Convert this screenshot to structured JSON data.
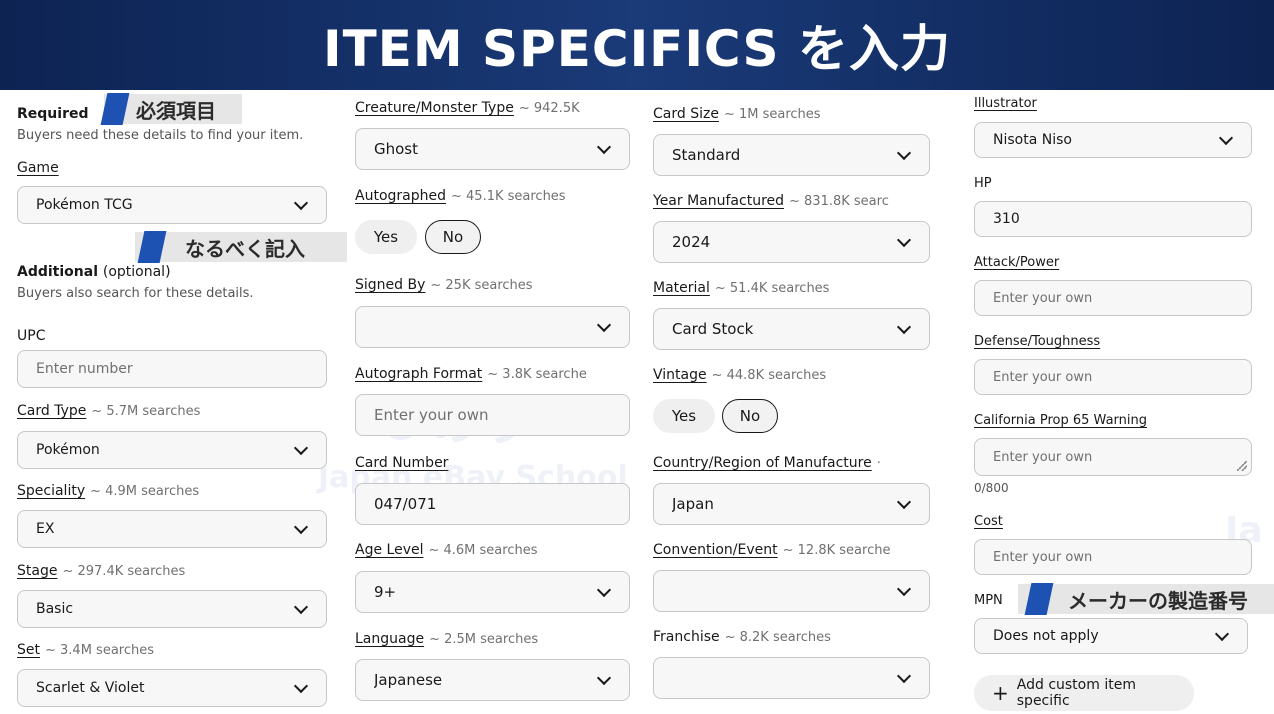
{
  "banner": {
    "title": "ITEM SPECIFICS を入力"
  },
  "watermark": {
    "mark": "©のり",
    "school": "Japan eBay School",
    "edge": "Ja"
  },
  "annotations": {
    "required": "必須項目",
    "recommended": "なるべく記入",
    "mpn": "メーカーの製造番号"
  },
  "required_section": {
    "title": "Required",
    "hint": "Buyers need these details to find your item."
  },
  "additional_section": {
    "title": "Additional",
    "optional": "(optional)",
    "hint": "Buyers also search for these details."
  },
  "fields": {
    "game": {
      "label": "Game",
      "value": "Pokémon TCG"
    },
    "upc": {
      "label": "UPC",
      "placeholder": "Enter number"
    },
    "card_type": {
      "label": "Card Type",
      "searches": "~ 5.7M searches",
      "value": "Pokémon"
    },
    "speciality": {
      "label": "Speciality",
      "searches": "~ 4.9M searches",
      "value": "EX"
    },
    "stage": {
      "label": "Stage",
      "searches": "~ 297.4K searches",
      "value": "Basic"
    },
    "set": {
      "label": "Set",
      "searches": "~ 3.4M searches",
      "value": "Scarlet & Violet"
    },
    "creature_type": {
      "label": "Creature/Monster Type",
      "searches": "~ 942.5K",
      "value": "Ghost"
    },
    "autographed": {
      "label": "Autographed",
      "searches": "~ 45.1K searches",
      "yes": "Yes",
      "no": "No"
    },
    "signed_by": {
      "label": "Signed By",
      "searches": "~ 25K searches",
      "value": ""
    },
    "autograph_format": {
      "label": "Autograph Format",
      "searches": "~ 3.8K searche",
      "placeholder": "Enter your own"
    },
    "card_number": {
      "label": "Card Number",
      "value": "047/071"
    },
    "age_level": {
      "label": "Age Level",
      "searches": "~ 4.6M searches",
      "value": "9+"
    },
    "language": {
      "label": "Language",
      "searches": "~ 2.5M searches",
      "value": "Japanese"
    },
    "card_size": {
      "label": "Card Size",
      "searches": "~ 1M searches",
      "value": "Standard"
    },
    "year_manufactured": {
      "label": "Year Manufactured",
      "searches": "~ 831.8K searc",
      "value": "2024"
    },
    "material": {
      "label": "Material",
      "searches": "~ 51.4K searches",
      "value": "Card Stock"
    },
    "vintage": {
      "label": "Vintage",
      "searches": "~ 44.8K searches",
      "yes": "Yes",
      "no": "No"
    },
    "country": {
      "label": "Country/Region of Manufacture",
      "searches": "·",
      "value": "Japan"
    },
    "convention": {
      "label": "Convention/Event",
      "searches": "~ 12.8K searche",
      "value": ""
    },
    "franchise": {
      "label": "Franchise",
      "searches": "~ 8.2K searches",
      "value": ""
    },
    "illustrator": {
      "label": "Illustrator",
      "value": "Nisota Niso"
    },
    "hp": {
      "label": "HP",
      "value": "310"
    },
    "attack_power": {
      "label": "Attack/Power",
      "placeholder": "Enter your own"
    },
    "defense": {
      "label": "Defense/Toughness",
      "placeholder": "Enter your own"
    },
    "prop65": {
      "label": "California Prop 65 Warning",
      "placeholder": "Enter your own",
      "counter": "0/800"
    },
    "cost": {
      "label": "Cost",
      "placeholder": "Enter your own"
    },
    "mpn": {
      "label": "MPN",
      "value": "Does not apply"
    }
  },
  "add_custom": {
    "label": "Add custom item specific"
  },
  "colors": {
    "banner": "#1a3a78",
    "flag": "#1d52b3"
  }
}
